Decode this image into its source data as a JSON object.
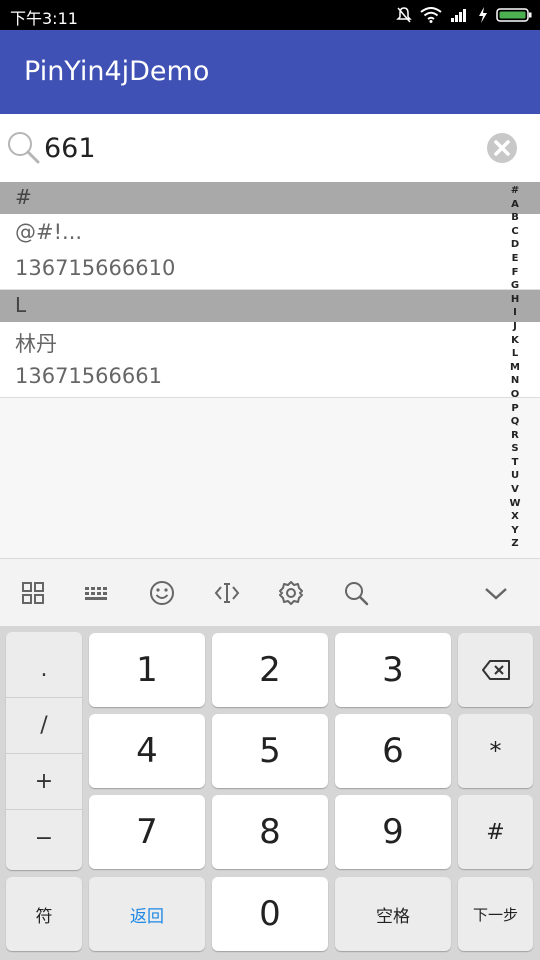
{
  "status_bar": {
    "time": "下午3:11",
    "icons": [
      "mute-icon",
      "wifi-icon",
      "signal-icon",
      "charging-icon",
      "battery-icon"
    ]
  },
  "app_bar": {
    "title": "PinYin4jDemo",
    "color": "#3f51b5"
  },
  "search": {
    "value": "661",
    "icon": "search-icon",
    "clear_icon": "clear-icon"
  },
  "list": {
    "sections": [
      {
        "header": "#",
        "contacts": [
          {
            "name": "@#!...",
            "phone": "136715666610"
          }
        ]
      },
      {
        "header": "L",
        "contacts": [
          {
            "name": "林丹",
            "phone": "13671566661"
          }
        ]
      }
    ]
  },
  "index_bar": [
    "#",
    "A",
    "B",
    "C",
    "D",
    "E",
    "F",
    "G",
    "H",
    "I",
    "J",
    "K",
    "L",
    "M",
    "N",
    "O",
    "P",
    "Q",
    "R",
    "S",
    "T",
    "U",
    "V",
    "W",
    "X",
    "Y",
    "Z"
  ],
  "keyboard_toolbar": [
    "grid-icon",
    "keyboard-icon",
    "emoji-icon",
    "cursor-icon",
    "settings-icon",
    "search-icon",
    "collapse-icon"
  ],
  "keyboard": {
    "symbols": [
      ".",
      "/",
      "+",
      "−"
    ],
    "digits": [
      "1",
      "2",
      "3",
      "4",
      "5",
      "6",
      "7",
      "8",
      "9",
      "0"
    ],
    "backspace_icon": "backspace-icon",
    "star": "*",
    "hash": "#",
    "symbol_key": "符",
    "back_key": "返回",
    "space_key": "空格",
    "next_key": "下一步",
    "back_key_color": "#1e88e5"
  }
}
